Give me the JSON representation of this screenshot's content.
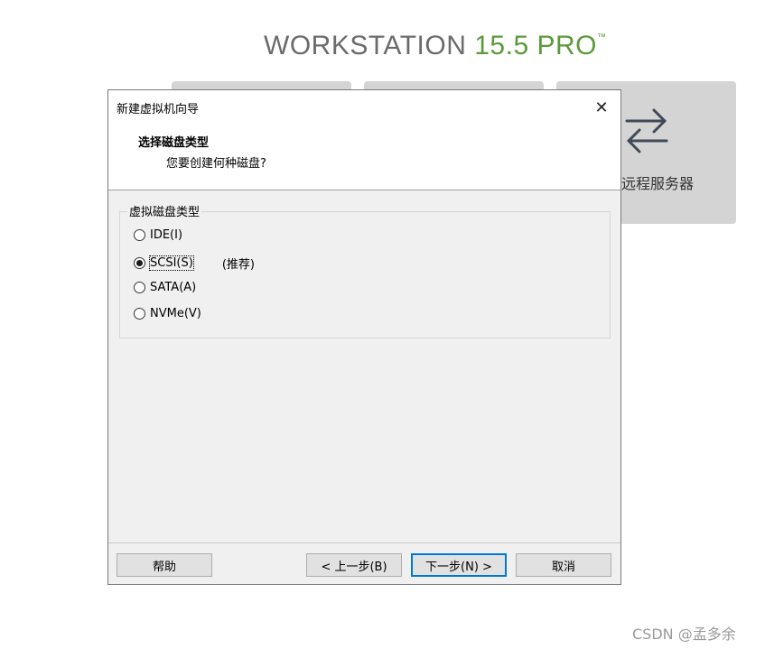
{
  "background": {
    "brand": {
      "name": "WORKSTATION",
      "version": "15.5",
      "edition": "PRO",
      "trademark": "™"
    },
    "remote_tile_label": "远程服务器",
    "accent_color": "#5b9a3c"
  },
  "dialog": {
    "title": "新建虚拟机向导",
    "close_icon": "close-icon",
    "heading": "选择磁盘类型",
    "subheading": "您要创建何种磁盘?",
    "group_label": "虚拟磁盘类型",
    "options": [
      {
        "label": "IDE(I)",
        "selected": false,
        "note": ""
      },
      {
        "label": "SCSI(S)",
        "selected": true,
        "note": "(推荐)"
      },
      {
        "label": "SATA(A)",
        "selected": false,
        "note": ""
      },
      {
        "label": "NVMe(V)",
        "selected": false,
        "note": ""
      }
    ],
    "buttons": {
      "help": "帮助",
      "back": "< 上一步(B)",
      "next": "下一步(N) >",
      "cancel": "取消"
    }
  },
  "watermark": "CSDN @孟多余"
}
